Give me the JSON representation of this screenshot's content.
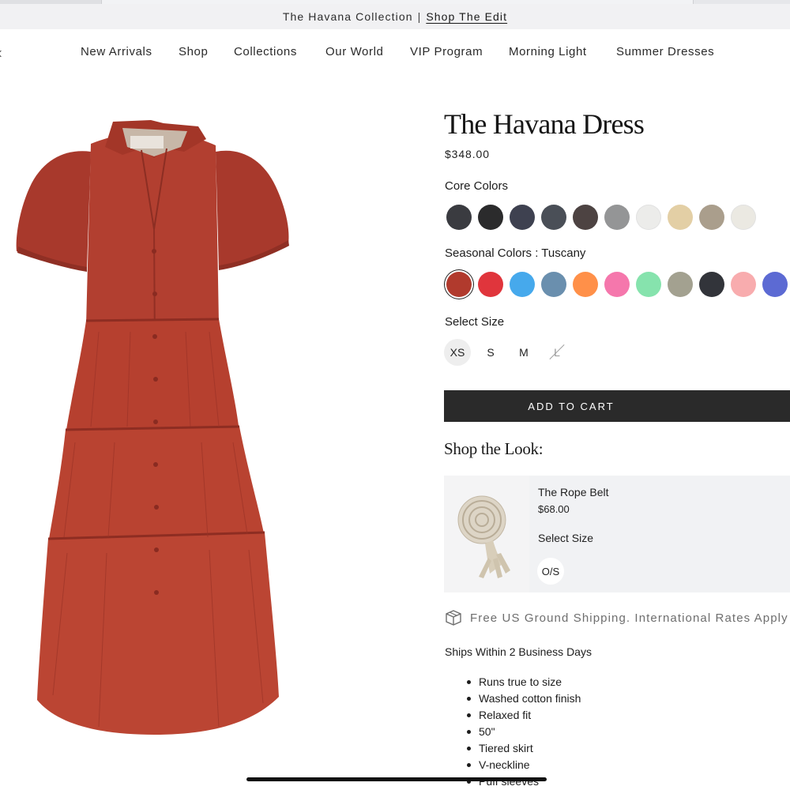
{
  "announcement": {
    "text": "The Havana Collection",
    "separator": "|",
    "link": "Shop The Edit"
  },
  "nav": {
    "items": [
      "New Arrivals",
      "Shop",
      "Collections",
      "Our World",
      "VIP Program",
      "Morning Light",
      "Summer Dresses"
    ]
  },
  "product": {
    "title": "The Havana Dress",
    "price": "$348.00",
    "image_icon": "red-tiered-dress-image",
    "core_colors_label": "Core Colors",
    "core_colors": [
      "#3a3b40",
      "#2b2b2c",
      "#3e4150",
      "#4a4f57",
      "#4d4342",
      "#949596",
      "#ececea",
      "#e3cfa5",
      "#aa9e8c",
      "#ebe9e2"
    ],
    "seasonal_colors_label": "Seasonal Colors : Tuscany",
    "seasonal_colors": [
      "#b13a2d",
      "#e0353c",
      "#46a9ec",
      "#6a8fae",
      "#ff9049",
      "#f577ac",
      "#86e3ad",
      "#a3a190",
      "#32343a",
      "#f8acae",
      "#5c6ad3"
    ],
    "selected_seasonal_index": 0,
    "select_size_label": "Select Size",
    "sizes": [
      "XS",
      "S",
      "M",
      "L"
    ],
    "selected_size": "XS",
    "unavailable_size": "L",
    "add_to_cart_label": "ADD TO CART"
  },
  "shop_the_look": {
    "heading": "Shop the Look:",
    "item": {
      "name": "The Rope Belt",
      "price": "$68.00",
      "select_size_label": "Select Size",
      "size": "O/S",
      "image_icon": "rope-belt-image"
    }
  },
  "shipping": {
    "icon": "box-icon",
    "text": "Free US Ground Shipping. International Rates Apply",
    "ships_within": "Ships Within 2 Business Days"
  },
  "features": [
    "Runs true to size",
    "Washed cotton finish",
    "Relaxed fit",
    "50\"",
    "Tiered skirt",
    "V-neckline",
    "Puff sleeves"
  ]
}
